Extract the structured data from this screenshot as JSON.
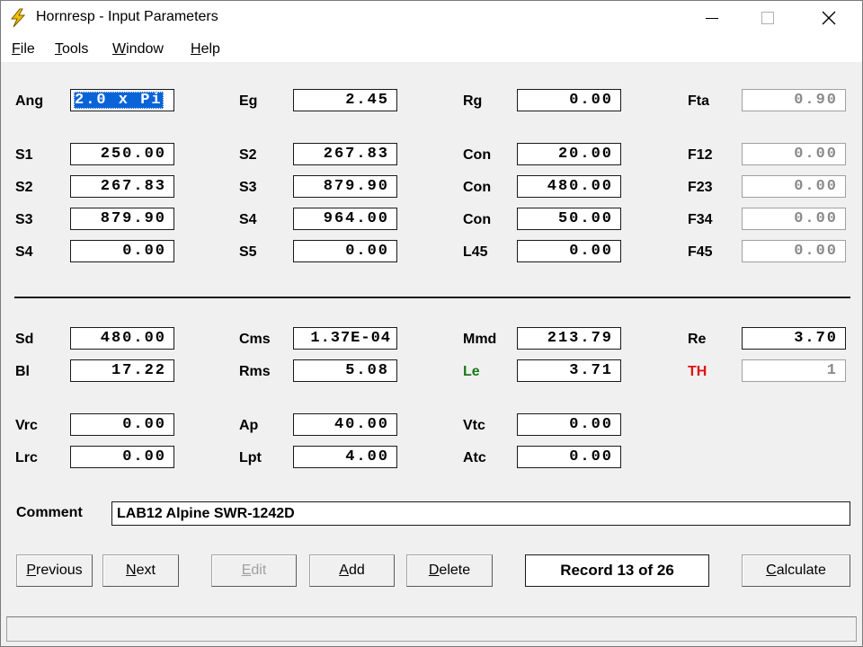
{
  "window": {
    "title": "Hornresp - Input Parameters",
    "icon": "lightning-bolt-icon",
    "controls": {
      "minimize": "minimize-icon",
      "maximize": "maximize-icon",
      "close": "close-icon"
    }
  },
  "menu": {
    "file": {
      "label_first": "F",
      "label_rest": "ile"
    },
    "tools": {
      "label_first": "T",
      "label_rest": "ools"
    },
    "window": {
      "label_first": "W",
      "label_rest": "indow"
    },
    "help": {
      "label_first": "H",
      "label_rest": "elp"
    }
  },
  "horn": {
    "ang_label": "Ang",
    "ang_value": "2.0 x Pi",
    "eg_label": "Eg",
    "eg_value": "2.45",
    "rg_label": "Rg",
    "rg_value": "0.00",
    "fta_label": "Fta",
    "fta_value": "0.90",
    "rows": [
      {
        "c1_label": "S1",
        "c1_value": "250.00",
        "c2_label": "S2",
        "c2_value": "267.83",
        "c3_label": "Con",
        "c3_value": "20.00",
        "c4_label": "F12",
        "c4_value": "0.00"
      },
      {
        "c1_label": "S2",
        "c1_value": "267.83",
        "c2_label": "S3",
        "c2_value": "879.90",
        "c3_label": "Con",
        "c3_value": "480.00",
        "c4_label": "F23",
        "c4_value": "0.00"
      },
      {
        "c1_label": "S3",
        "c1_value": "879.90",
        "c2_label": "S4",
        "c2_value": "964.00",
        "c3_label": "Con",
        "c3_value": "50.00",
        "c4_label": "F34",
        "c4_value": "0.00"
      },
      {
        "c1_label": "S4",
        "c1_value": "0.00",
        "c2_label": "S5",
        "c2_value": "0.00",
        "c3_label": "L45",
        "c3_value": "0.00",
        "c4_label": "F45",
        "c4_value": "0.00"
      }
    ]
  },
  "driver": {
    "sd_label": "Sd",
    "sd_value": "480.00",
    "cms_label": "Cms",
    "cms_value": "1.37E-04",
    "mmd_label": "Mmd",
    "mmd_value": "213.79",
    "re_label": "Re",
    "re_value": "3.70",
    "bl_label": "Bl",
    "bl_value": "17.22",
    "rms_label": "Rms",
    "rms_value": "5.08",
    "le_label": "Le",
    "le_value": "3.71",
    "th_label": "TH",
    "th_value": "1"
  },
  "chambers": {
    "vrc_label": "Vrc",
    "vrc_value": "0.00",
    "ap_label": "Ap",
    "ap_value": "40.00",
    "vtc_label": "Vtc",
    "vtc_value": "0.00",
    "lrc_label": "Lrc",
    "lrc_value": "0.00",
    "lpt_label": "Lpt",
    "lpt_value": "4.00",
    "atc_label": "Atc",
    "atc_value": "0.00"
  },
  "comment": {
    "label": "Comment",
    "value": "LAB12 Alpine SWR-1242D"
  },
  "buttons": {
    "previous": {
      "first": "P",
      "rest": "revious"
    },
    "next": {
      "first": "N",
      "rest": "ext"
    },
    "edit": {
      "first": "E",
      "rest": "dit"
    },
    "add": {
      "first": "A",
      "rest": "dd"
    },
    "delete": {
      "first": "D",
      "rest": "elete"
    },
    "calculate": {
      "first": "C",
      "rest": "alculate"
    }
  },
  "record": "Record 13 of 26",
  "colors": {
    "selection": "#0a64d8",
    "le_label": "#1a7a1a",
    "th_label": "#e01010",
    "lightning": "#f2c200"
  }
}
